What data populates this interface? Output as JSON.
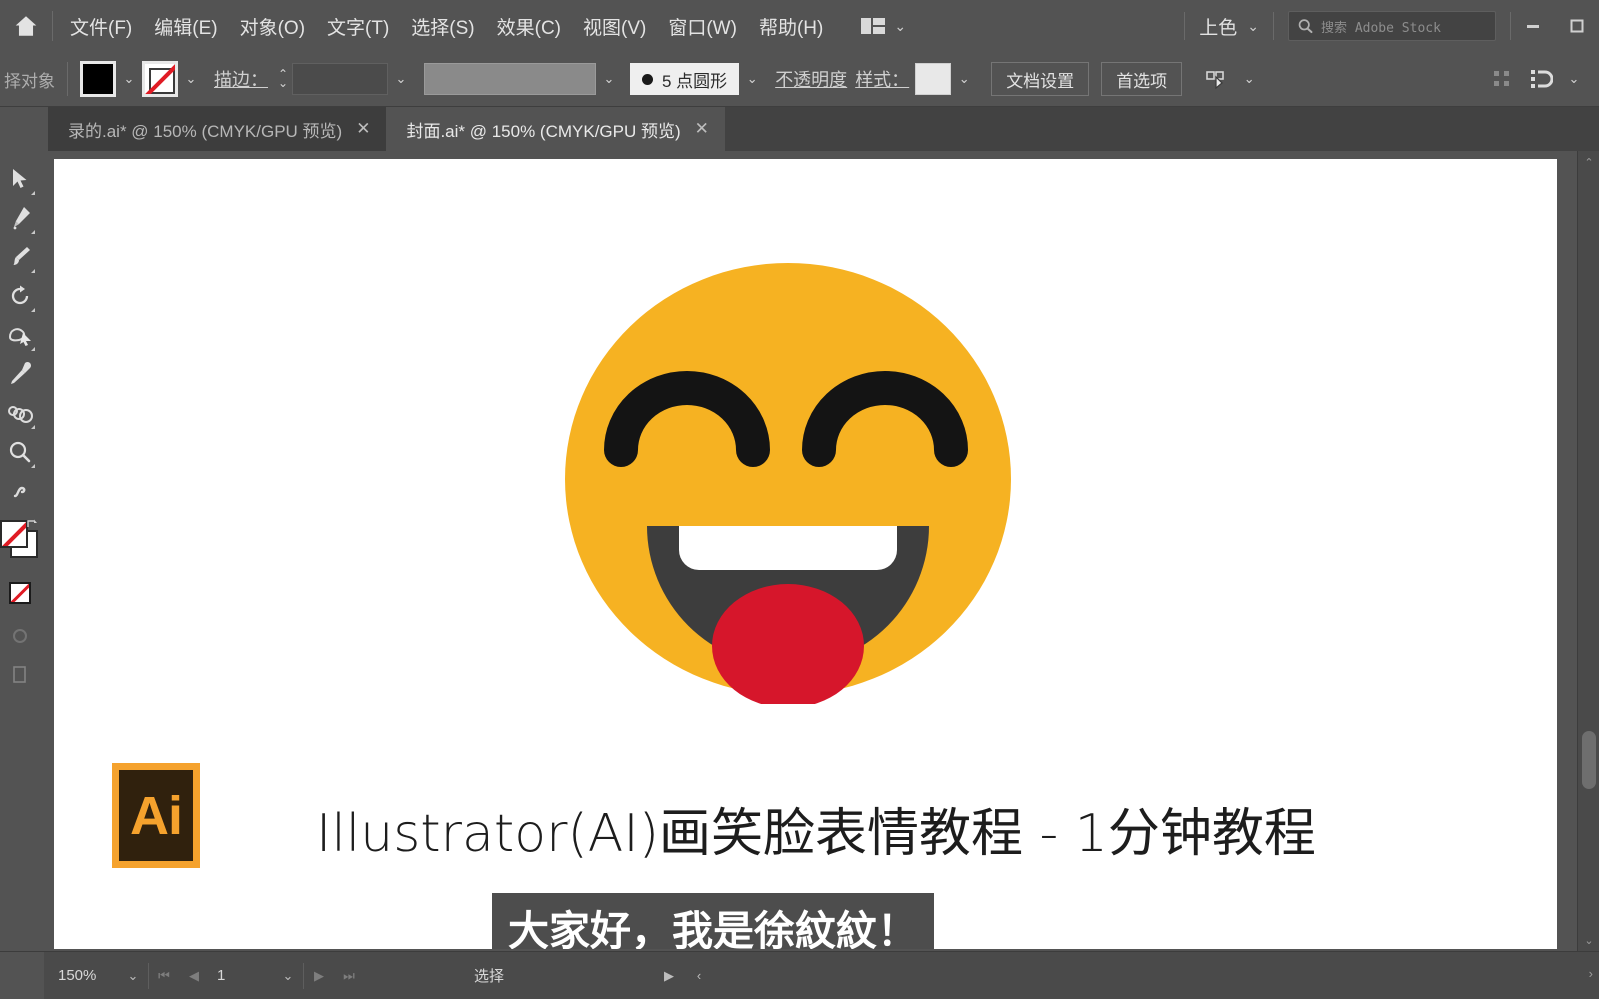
{
  "app": {
    "name": "Adobe Illustrator",
    "theme_bg": "#535353",
    "accent": "#f5a22d"
  },
  "menubar": {
    "home_icon": "home-icon",
    "items": [
      {
        "label": "文件(F)"
      },
      {
        "label": "编辑(E)"
      },
      {
        "label": "对象(O)"
      },
      {
        "label": "文字(T)"
      },
      {
        "label": "选择(S)"
      },
      {
        "label": "效果(C)"
      },
      {
        "label": "视图(V)"
      },
      {
        "label": "窗口(W)"
      },
      {
        "label": "帮助(H)"
      }
    ],
    "arrange_documents_icon": "arrange-documents-icon",
    "arrange_chevron": "⌄",
    "workspace": {
      "label": "上色",
      "chevron": "⌄"
    },
    "stock_search": {
      "icon": "search-icon",
      "placeholder": "搜索 Adobe Stock",
      "value": ""
    },
    "window_controls": {
      "minimize": "minimize-icon",
      "maximize": "maximize-icon"
    }
  },
  "controlbar": {
    "selection_label": "择对象",
    "fill_swatch": {
      "name": "fill-swatch",
      "color": "#000000"
    },
    "stroke_swatch": {
      "name": "stroke-swatch",
      "color": "none"
    },
    "stroke_label": "描边：",
    "stroke_weight_value": "",
    "stroke_profile_value": "",
    "brush_definition": {
      "label": "5 点圆形",
      "marker": "dot"
    },
    "opacity_label": "不透明度",
    "style_label": "样式：",
    "style_swatch_color": "#e8e8e8",
    "doc_setup_label": "文档设置",
    "preferences_label": "首选项",
    "select_similar_icon": "select-similar-objects-icon",
    "align_icon": "align-grid-icon",
    "distribute_icon": "distribute-icon",
    "chevron": "⌄"
  },
  "tabs": [
    {
      "label": "录的.ai* @ 150% (CMYK/GPU 预览)",
      "active": false,
      "close": "✕"
    },
    {
      "label": "封面.ai* @ 150% (CMYK/GPU 预览)",
      "active": true,
      "close": "✕"
    }
  ],
  "toolbar": {
    "tools": [
      {
        "name": "selection-tool",
        "icon": "arrow-cursor-icon",
        "has_flyout": true
      },
      {
        "name": "pen-tool",
        "icon": "pen-icon",
        "has_flyout": true
      },
      {
        "name": "paintbrush-tool",
        "icon": "paintbrush-icon",
        "has_flyout": true
      },
      {
        "name": "rotate-tool",
        "icon": "rotate-icon",
        "has_flyout": true
      },
      {
        "name": "width-warp-tool",
        "icon": "warp-icon",
        "has_flyout": true
      },
      {
        "name": "eyedropper-tool",
        "icon": "eyedropper-icon",
        "has_flyout": false
      },
      {
        "name": "blend-tool",
        "icon": "blend-icon",
        "has_flyout": true
      },
      {
        "name": "zoom-tool",
        "icon": "magnifier-icon",
        "has_flyout": true
      },
      {
        "name": "shaper-tool",
        "icon": "shaper-icon",
        "has_flyout": false
      }
    ],
    "fill_stroke": {
      "fill_color": "#ffffff",
      "stroke_color": "none",
      "swap_icon": "swap-fill-stroke-icon"
    },
    "none_swatch": "none-swatch-icon",
    "drawing_mode_icon": "draw-normal-icon"
  },
  "canvas": {
    "artwork": {
      "type": "smiley-face-emoji",
      "face_color": "#f6b222",
      "eye_color": "#1a1a1a",
      "mouth_color": "#3d3d3d",
      "teeth_color": "#ffffff",
      "tongue_color": "#d6162b"
    },
    "logo": {
      "name": "adobe-illustrator-logo",
      "text": "Ai",
      "border_color": "#f5a22d",
      "inner_color": "#30210d"
    },
    "title": "Illustrator(AI)画笑脸表情教程 - 1分钟教程",
    "subtitle": "大家好，我是徐紋紋！",
    "subtitle_bg": "#4d4d4d"
  },
  "statusbar": {
    "zoom_level": "150%",
    "zoom_chevron": "⌄",
    "first_page_icon": "⏮",
    "prev_page_icon": "◀",
    "page_number": "1",
    "page_chevron": "⌄",
    "next_page_icon": "▶",
    "last_page_icon": "⏭",
    "status_text": "选择",
    "play_icon": "▶",
    "collapse_icon": "‹"
  }
}
